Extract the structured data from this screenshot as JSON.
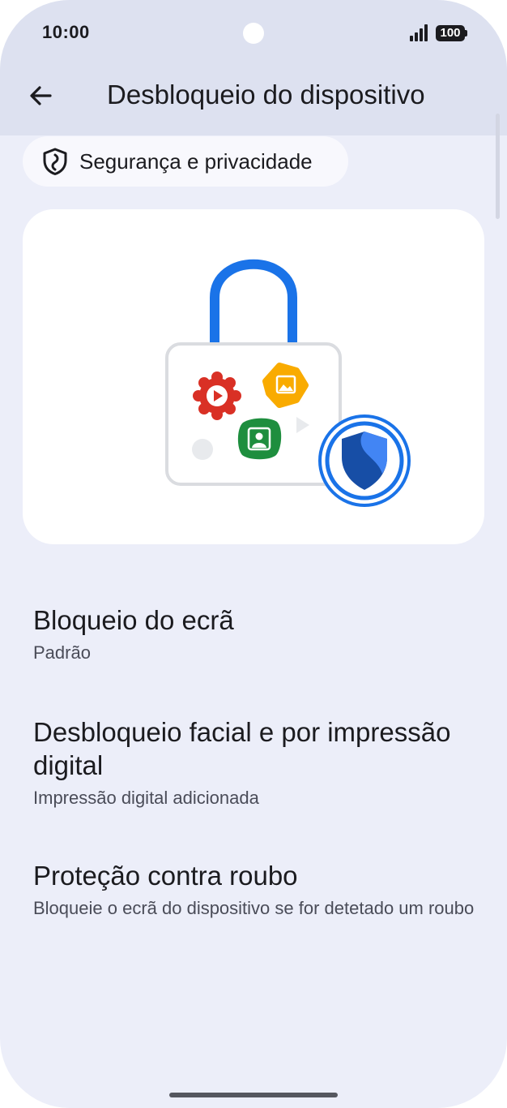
{
  "status_bar": {
    "time": "10:00",
    "battery": "100"
  },
  "header": {
    "title": "Desbloqueio do dispositivo"
  },
  "breadcrumb": {
    "label": "Segurança e privacidade"
  },
  "items": [
    {
      "title": "Bloqueio do ecrã",
      "subtitle": "Padrão"
    },
    {
      "title": "Desbloqueio facial e por impressão digital",
      "subtitle": "Impressão digital adicionada"
    },
    {
      "title": "Proteção contra roubo",
      "subtitle": "Bloqueie o ecrã do dispositivo se for detetado um roubo"
    }
  ],
  "colors": {
    "background": "#eceef9",
    "header": "#dde1f0",
    "accent_blue": "#1a73e8",
    "red": "#d93025",
    "yellow": "#f9ab00",
    "green": "#1e8e3e"
  }
}
